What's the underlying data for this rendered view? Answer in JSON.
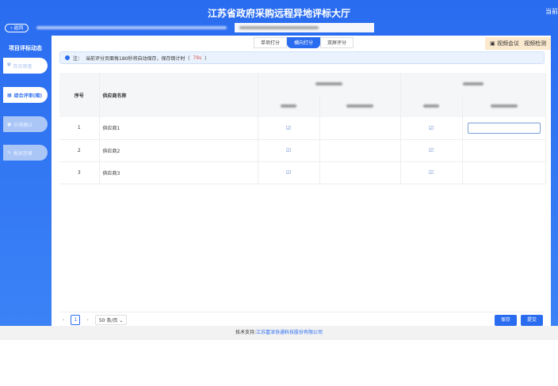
{
  "header": {
    "title": "江苏省政府采购远程异地评标大厅",
    "user": "当前",
    "back_label": "返回"
  },
  "sidebar": {
    "title": "项目评标动态",
    "items": [
      {
        "label": "符合审查",
        "icon": "shield-icon"
      },
      {
        "label": "综合评审(暗)",
        "icon": "grid-icon"
      },
      {
        "label": "价格确认",
        "icon": "circle-icon"
      },
      {
        "label": "报表签章",
        "icon": "pen-icon"
      }
    ]
  },
  "tabs": [
    {
      "label": "单项打分"
    },
    {
      "label": "横向打分",
      "active": true
    },
    {
      "label": "双屏评分"
    }
  ],
  "video": {
    "meeting": "视频会议",
    "check": "视频检测"
  },
  "note": {
    "prefix": "注：",
    "text": "当前评分页面每180秒将自动保存，保存倒计时（",
    "countdown": "79s",
    "suffix": "）"
  },
  "table": {
    "headers": {
      "index": "序号",
      "name": "供应商名称"
    },
    "rows": [
      {
        "index": "1",
        "name": "供应商1"
      },
      {
        "index": "2",
        "name": "供应商2"
      },
      {
        "index": "3",
        "name": "供应商3"
      }
    ],
    "edit_icon": "edit-icon"
  },
  "pagination": {
    "page": "1",
    "page_size": "50 条/页"
  },
  "actions": {
    "save": "保存",
    "submit": "提交"
  },
  "footer": {
    "prefix": "技术支持:",
    "company": "江苏富深协通科技股份有限公司"
  },
  "colors": {
    "primary": "#2a6cf0",
    "countdown": "#d9534f"
  }
}
